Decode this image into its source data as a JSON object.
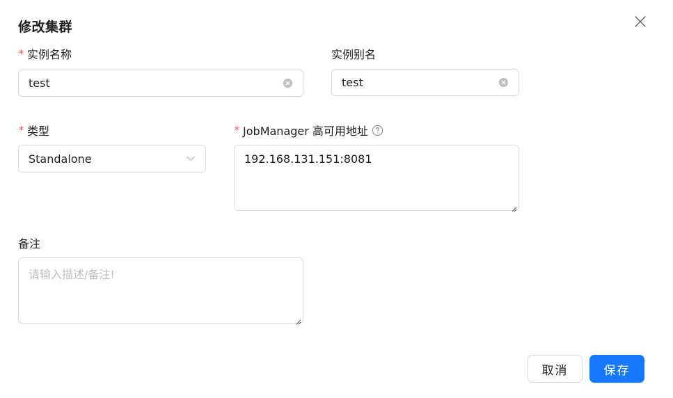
{
  "dialog": {
    "title": "修改集群",
    "close_icon": "close-icon"
  },
  "form": {
    "instance_name": {
      "label": "实例名称",
      "required": true,
      "required_mark": "*",
      "value": "test"
    },
    "instance_alias": {
      "label": "实例别名",
      "required": false,
      "value": "test"
    },
    "type": {
      "label": "类型",
      "required": true,
      "required_mark": "*",
      "selected": "Standalone"
    },
    "jobmanager_address": {
      "label": "JobManager 高可用地址",
      "required": true,
      "required_mark": "*",
      "help_icon": "question-circle-icon",
      "value": "192.168.131.151:8081"
    },
    "note": {
      "label": "备注",
      "required": false,
      "placeholder": "请输入描述/备注!"
    }
  },
  "footer": {
    "cancel_label": "取消",
    "save_label": "保存"
  },
  "colors": {
    "primary": "#1677ff",
    "required": "#ff4d4f",
    "border": "#d9d9d9",
    "placeholder": "#bfbfbf"
  }
}
